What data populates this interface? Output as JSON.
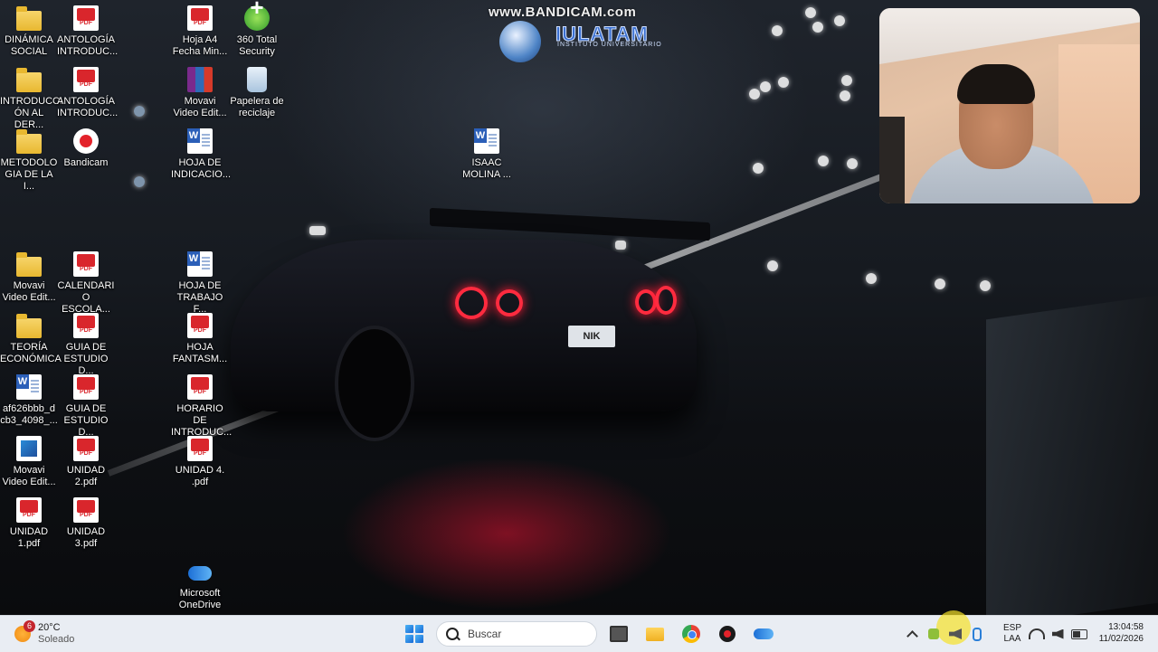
{
  "recording_watermark": {
    "text": "www.BANDICAM.com",
    "logo_title": "IULATAM",
    "logo_subtitle": "INSTITUTO UNIVERSITARIO"
  },
  "desktop_icons": [
    {
      "name": "folder-icon",
      "label": "DINÁMICA SOCIAL"
    },
    {
      "name": "pdf-icon",
      "label": "ANTOLOGÍA INTRODUC..."
    },
    {
      "name": "folder-icon",
      "label": "INTRODUCCI ÓN AL DER..."
    },
    {
      "name": "pdf-icon",
      "label": "ANTOLOGÍA INTRODUC..."
    },
    {
      "name": "folder-icon",
      "label": "METODOLO GIA DE LA I..."
    },
    {
      "name": "bandicam-icon",
      "label": "Bandicam"
    },
    {
      "name": "folder-icon",
      "label": "Movavi Video Edit..."
    },
    {
      "name": "pdf-icon",
      "label": "CALENDARI O ESCOLA..."
    },
    {
      "name": "folder-icon",
      "label": "TEORÍA ECONÓMICA"
    },
    {
      "name": "pdf-icon",
      "label": "GUIA DE ESTUDIO D..."
    },
    {
      "name": "word-icon",
      "label": "af626bbb_d cb3_4098_..."
    },
    {
      "name": "pdf-icon",
      "label": "GUIA DE ESTUDIO D..."
    },
    {
      "name": "movavi-icon",
      "label": "Movavi Video Edit..."
    },
    {
      "name": "pdf-icon",
      "label": "UNIDAD 2.pdf"
    },
    {
      "name": "pdf-icon",
      "label": "UNIDAD 1.pdf"
    },
    {
      "name": "pdf-icon",
      "label": "UNIDAD 3.pdf"
    },
    {
      "name": "pdf-icon",
      "label": "Hoja A4 Fecha Min..."
    },
    {
      "name": "360-security-icon",
      "label": "360 Total Security"
    },
    {
      "name": "winrar-icon",
      "label": "Movavi Video Edit..."
    },
    {
      "name": "recycle-bin-icon",
      "label": "Papelera de reciclaje"
    },
    {
      "name": "word-icon",
      "label": "HOJA DE INDICACIO..."
    },
    {
      "name": "word-icon",
      "label": "ISAAC MOLINA ..."
    },
    {
      "name": "word-icon",
      "label": "HOJA DE TRABAJO F..."
    },
    {
      "name": "pdf-icon",
      "label": "HOJA FANTASM..."
    },
    {
      "name": "pdf-icon",
      "label": "HORARIO DE INTRODUC..."
    },
    {
      "name": "pdf-icon",
      "label": "UNIDAD 4. .pdf"
    },
    {
      "name": "onedrive-icon",
      "label": "Microsoft OneDrive"
    }
  ],
  "wallpaper": {
    "plate_text": "NIK"
  },
  "taskbar": {
    "weather": {
      "badge": "6",
      "temperature": "20°C",
      "condition": "Soleado"
    },
    "search_placeholder": "Buscar",
    "language": {
      "line1": "ESP",
      "line2": "LAA"
    },
    "clock": {
      "time": "13:04:58",
      "date": "11/02/2026"
    }
  },
  "colors": {
    "taskbar_bg": "#e9edf3",
    "accent": "#1769d6",
    "pdf_red": "#d9262c"
  }
}
